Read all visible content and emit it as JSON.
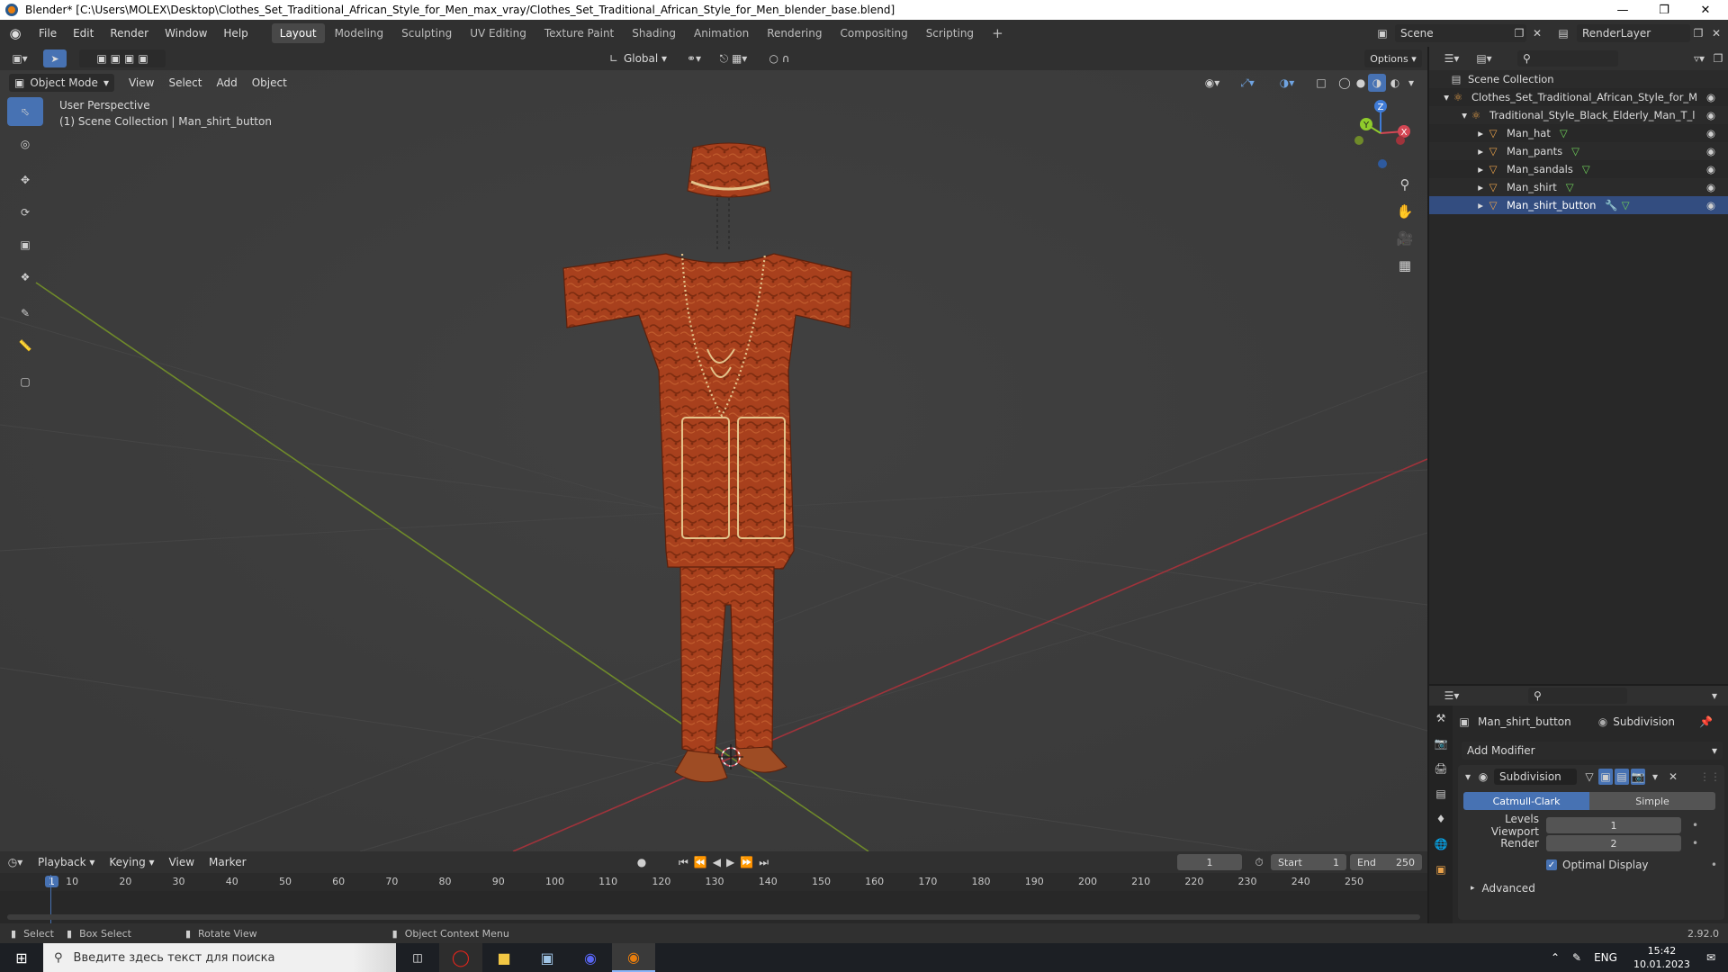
{
  "window": {
    "title": "Blender* [C:\\Users\\MOLEX\\Desktop\\Clothes_Set_Traditional_African_Style_for_Men_max_vray/Clothes_Set_Traditional_African_Style_for_Men_blender_base.blend]"
  },
  "menubar": {
    "items": [
      "File",
      "Edit",
      "Render",
      "Window",
      "Help"
    ],
    "workspaces": [
      "Layout",
      "Modeling",
      "Sculpting",
      "UV Editing",
      "Texture Paint",
      "Shading",
      "Animation",
      "Rendering",
      "Compositing",
      "Scripting"
    ],
    "active_workspace": "Layout",
    "add_tab": "+",
    "scene_name": "Scene",
    "view_layer": "RenderLayer"
  },
  "tool_header": {
    "orientation": "Global",
    "options_label": "Options"
  },
  "viewport_header": {
    "mode": "Object Mode",
    "menus": [
      "View",
      "Select",
      "Add",
      "Object"
    ]
  },
  "viewport": {
    "perspective_label": "User Perspective",
    "context_label": "(1) Scene Collection | Man_shirt_button",
    "gizmo": {
      "x_label": "X",
      "y_label": "Y",
      "z_label": "Z"
    }
  },
  "outliner": {
    "search_placeholder": "",
    "rows": [
      {
        "label": "Scene Collection",
        "depth": 0,
        "type": "collection"
      },
      {
        "label": "Clothes_Set_Traditional_African_Style_for_M",
        "depth": 1,
        "type": "empty"
      },
      {
        "label": "Traditional_Style_Black_Elderly_Man_T_l",
        "depth": 2,
        "type": "empty"
      },
      {
        "label": "Man_hat",
        "depth": 3,
        "type": "mesh"
      },
      {
        "label": "Man_pants",
        "depth": 3,
        "type": "mesh"
      },
      {
        "label": "Man_sandals",
        "depth": 3,
        "type": "mesh"
      },
      {
        "label": "Man_shirt",
        "depth": 3,
        "type": "mesh"
      },
      {
        "label": "Man_shirt_button",
        "depth": 3,
        "type": "mesh"
      }
    ]
  },
  "properties": {
    "object_name": "Man_shirt_button",
    "modifier_breadcrumb": "Subdivision",
    "add_modifier_label": "Add Modifier",
    "modifier": {
      "name": "Subdivision",
      "type_options": [
        "Catmull-Clark",
        "Simple"
      ],
      "active_type": "Catmull-Clark",
      "levels_viewport_label": "Levels Viewport",
      "levels_viewport_value": "1",
      "render_label": "Render",
      "render_value": "2",
      "optimal_display_label": "Optimal Display",
      "optimal_display_checked": true,
      "advanced_label": "Advanced"
    }
  },
  "timeline": {
    "menus": [
      "Playback",
      "Keying",
      "View",
      "Marker"
    ],
    "current_frame": "1",
    "start_label": "Start",
    "start_value": "1",
    "end_label": "End",
    "end_value": "250",
    "ticks": [
      "1",
      "10",
      "20",
      "30",
      "40",
      "50",
      "60",
      "70",
      "80",
      "90",
      "100",
      "110",
      "120",
      "130",
      "140",
      "150",
      "160",
      "170",
      "180",
      "190",
      "200",
      "210",
      "220",
      "230",
      "240",
      "250"
    ]
  },
  "statusbar": {
    "select": "Select",
    "box_select": "Box Select",
    "rotate_view": "Rotate View",
    "context_menu": "Object Context Menu",
    "version": "2.92.0"
  },
  "taskbar": {
    "search_placeholder": "Введите здесь текст для поиска",
    "language": "ENG",
    "time": "15:42",
    "date": "10.01.2023"
  },
  "colors": {
    "accent": "#4772b3",
    "viewport_bg": "#3d3d3d",
    "panel_bg": "#282828",
    "axis_x": "#d44754",
    "axis_y": "#8fcb2b",
    "axis_z": "#3f7bd6",
    "garment": "#a8401d"
  }
}
